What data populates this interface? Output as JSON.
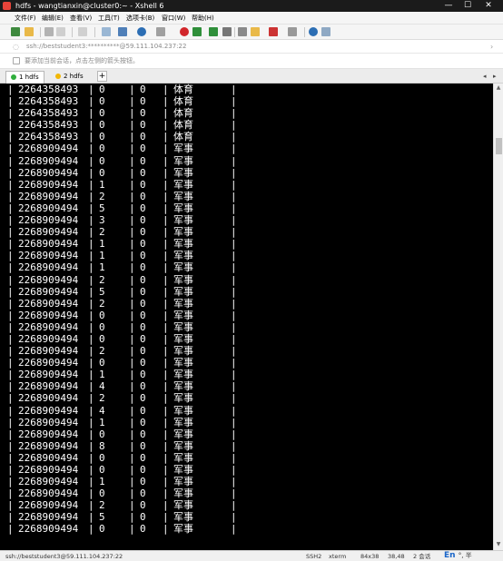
{
  "titlebar": {
    "title": "hdfs - wangtianxin@cluster0:~ - Xshell 6",
    "minimize": "—",
    "maximize": "☐",
    "close": "✕"
  },
  "menu": [
    "文件(F)",
    "编辑(E)",
    "查看(V)",
    "工具(T)",
    "选项卡(B)",
    "窗口(W)",
    "帮助(H)"
  ],
  "address": {
    "text": "ssh://beststudent3:**********@59.111.104.237:22"
  },
  "hint": {
    "text": "要添加当前会话，点击左侧的箭头按钮。"
  },
  "tabs": [
    {
      "label": "1 hdfs",
      "active": true,
      "dot_color": "#2fae3c"
    },
    {
      "label": "2 hdfs",
      "active": false,
      "dot_color": "#f2b705"
    }
  ],
  "tab_add": "+",
  "terminal": {
    "rows": [
      {
        "id": "2264358493",
        "v1": "0",
        "v2": "0",
        "cat": "体育"
      },
      {
        "id": "2264358493",
        "v1": "0",
        "v2": "0",
        "cat": "体育"
      },
      {
        "id": "2264358493",
        "v1": "0",
        "v2": "0",
        "cat": "体育"
      },
      {
        "id": "2264358493",
        "v1": "0",
        "v2": "0",
        "cat": "体育"
      },
      {
        "id": "2264358493",
        "v1": "0",
        "v2": "0",
        "cat": "体育"
      },
      {
        "id": "2268909494",
        "v1": "0",
        "v2": "0",
        "cat": "军事"
      },
      {
        "id": "2268909494",
        "v1": "0",
        "v2": "0",
        "cat": "军事"
      },
      {
        "id": "2268909494",
        "v1": "0",
        "v2": "0",
        "cat": "军事"
      },
      {
        "id": "2268909494",
        "v1": "1",
        "v2": "0",
        "cat": "军事"
      },
      {
        "id": "2268909494",
        "v1": "2",
        "v2": "0",
        "cat": "军事"
      },
      {
        "id": "2268909494",
        "v1": "5",
        "v2": "0",
        "cat": "军事"
      },
      {
        "id": "2268909494",
        "v1": "3",
        "v2": "0",
        "cat": "军事"
      },
      {
        "id": "2268909494",
        "v1": "2",
        "v2": "0",
        "cat": "军事"
      },
      {
        "id": "2268909494",
        "v1": "1",
        "v2": "0",
        "cat": "军事"
      },
      {
        "id": "2268909494",
        "v1": "1",
        "v2": "0",
        "cat": "军事"
      },
      {
        "id": "2268909494",
        "v1": "1",
        "v2": "0",
        "cat": "军事"
      },
      {
        "id": "2268909494",
        "v1": "2",
        "v2": "0",
        "cat": "军事"
      },
      {
        "id": "2268909494",
        "v1": "5",
        "v2": "0",
        "cat": "军事"
      },
      {
        "id": "2268909494",
        "v1": "2",
        "v2": "0",
        "cat": "军事"
      },
      {
        "id": "2268909494",
        "v1": "0",
        "v2": "0",
        "cat": "军事"
      },
      {
        "id": "2268909494",
        "v1": "0",
        "v2": "0",
        "cat": "军事"
      },
      {
        "id": "2268909494",
        "v1": "0",
        "v2": "0",
        "cat": "军事"
      },
      {
        "id": "2268909494",
        "v1": "2",
        "v2": "0",
        "cat": "军事"
      },
      {
        "id": "2268909494",
        "v1": "0",
        "v2": "0",
        "cat": "军事"
      },
      {
        "id": "2268909494",
        "v1": "1",
        "v2": "0",
        "cat": "军事"
      },
      {
        "id": "2268909494",
        "v1": "4",
        "v2": "0",
        "cat": "军事"
      },
      {
        "id": "2268909494",
        "v1": "2",
        "v2": "0",
        "cat": "军事"
      },
      {
        "id": "2268909494",
        "v1": "4",
        "v2": "0",
        "cat": "军事"
      },
      {
        "id": "2268909494",
        "v1": "1",
        "v2": "0",
        "cat": "军事"
      },
      {
        "id": "2268909494",
        "v1": "0",
        "v2": "0",
        "cat": "军事"
      },
      {
        "id": "2268909494",
        "v1": "8",
        "v2": "0",
        "cat": "军事"
      },
      {
        "id": "2268909494",
        "v1": "0",
        "v2": "0",
        "cat": "军事"
      },
      {
        "id": "2268909494",
        "v1": "0",
        "v2": "0",
        "cat": "军事"
      },
      {
        "id": "2268909494",
        "v1": "1",
        "v2": "0",
        "cat": "军事"
      },
      {
        "id": "2268909494",
        "v1": "0",
        "v2": "0",
        "cat": "军事"
      },
      {
        "id": "2268909494",
        "v1": "2",
        "v2": "0",
        "cat": "军事"
      },
      {
        "id": "2268909494",
        "v1": "5",
        "v2": "0",
        "cat": "军事"
      },
      {
        "id": "2268909494",
        "v1": "0",
        "v2": "0",
        "cat": "军事"
      }
    ]
  },
  "status": {
    "connection": "ssh://beststudent3@59.111.104.237:22",
    "protocol": "SSH2",
    "terminal_type": "xterm",
    "size": "84x38",
    "cursor": "38,48",
    "sessions": "2 会话",
    "ime_lang": "En",
    "ime_extra": "°, 半"
  },
  "colors": {
    "title_bg": "#1b1b1b",
    "terminal_bg": "#000000",
    "terminal_fg": "#ffffff"
  }
}
